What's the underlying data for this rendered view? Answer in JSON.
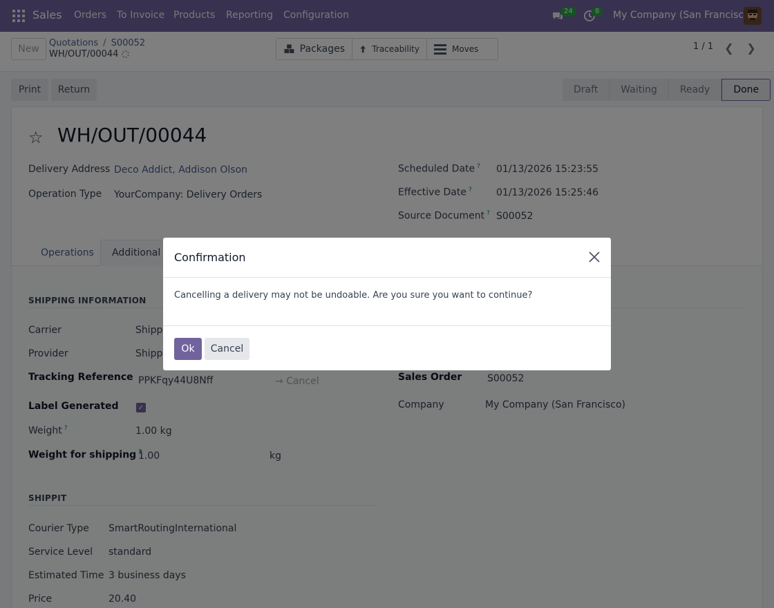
{
  "navbar": {
    "app": "Sales",
    "menu": [
      "Orders",
      "To Invoice",
      "Products",
      "Reporting",
      "Configuration"
    ],
    "messages_count": "24",
    "activities_count": "8",
    "company": "My Company (San Francisco)",
    "icons": [
      "apps-grid-icon",
      "chat-icon",
      "clock-icon"
    ]
  },
  "control": {
    "new_label": "New",
    "breadcrumb": [
      "Quotations",
      "S00052"
    ],
    "record": "WH/OUT/00044",
    "smart_buttons": [
      "Packages",
      "Traceability",
      "Moves"
    ],
    "pager": "1 / 1"
  },
  "actions": {
    "print": "Print",
    "return": "Return"
  },
  "stages": [
    "Draft",
    "Waiting",
    "Ready",
    "Done"
  ],
  "active_stage": "Done",
  "form": {
    "title": "WH/OUT/00044",
    "delivery_address_label": "Delivery Address",
    "delivery_address_value": "Deco Addict, Addison Olson",
    "operation_type_label": "Operation Type",
    "operation_type_value": "YourCompany: Delivery Orders",
    "scheduled_date_label": "Scheduled Date",
    "scheduled_date_value": "01/13/2026 15:23:55",
    "effective_date_label": "Effective Date",
    "effective_date_value": "01/13/2026 15:25:46",
    "source_document_label": "Source Document",
    "source_document_value": "S00052",
    "help_mark": "?"
  },
  "tabs": [
    "Operations",
    "Additional In"
  ],
  "shipping": {
    "section": "SHIPPING INFORMATION",
    "carrier_label": "Carrier",
    "carrier_value": "Shippi",
    "provider_label": "Provider",
    "provider_value": "Shippi",
    "tracking_label": "Tracking Reference",
    "tracking_value": "PPKFqy44U8Nff",
    "tracking_cancel": "Cancel",
    "label_generated_label": "Label Generated",
    "weight_label": "Weight",
    "weight_value": "1.00",
    "weight_unit": "kg",
    "weight_shipping_label": "Weight for shipping",
    "weight_shipping_value": "1.00",
    "weight_shipping_unit": "kg"
  },
  "other": {
    "sales_order_label": "Sales Order",
    "sales_order_value": "S00052",
    "company_label": "Company",
    "company_value": "My Company (San Francisco)"
  },
  "shippit": {
    "section": "SHIPPIT",
    "courier_label": "Courier Type",
    "courier_value": "SmartRoutingInternational",
    "service_label": "Service Level",
    "service_value": "standard",
    "time_label": "Estimated Time",
    "time_value": "3 business days",
    "price_label": "Price",
    "price_value": "20.40"
  },
  "modal": {
    "title": "Confirmation",
    "body": "Cancelling a delivery may not be undoable. Are you sure you want to continue?",
    "ok": "Ok",
    "cancel": "Cancel"
  }
}
